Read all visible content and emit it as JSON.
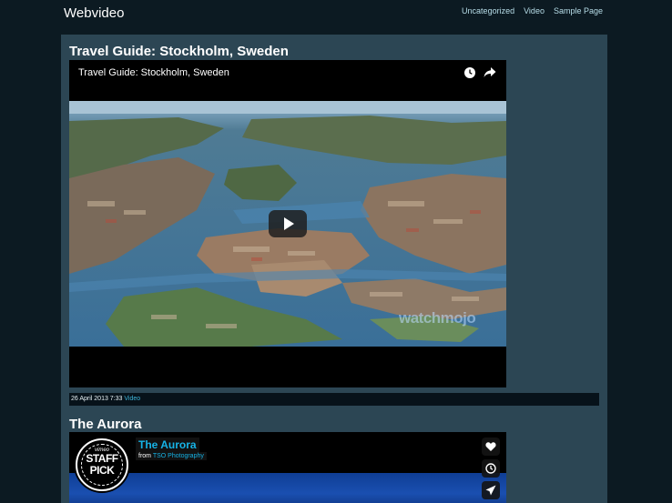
{
  "site": {
    "title": "Webvideo"
  },
  "nav": {
    "items": [
      "Uncategorized",
      "Video",
      "Sample Page"
    ]
  },
  "posts": [
    {
      "title": "Travel Guide: Stockholm, Sweden",
      "player": {
        "title": "Travel Guide: Stockholm, Sweden",
        "watermark": "watchmojo"
      },
      "meta": {
        "date": "26 April 2013 7:33",
        "category": "Video"
      }
    },
    {
      "title": "The Aurora",
      "player": {
        "badge_brand": "vimeo",
        "badge_line1": "STAFF",
        "badge_line2": "PICK",
        "title": "The Aurora",
        "from_label": "from",
        "author": "TSO Photography"
      }
    }
  ],
  "colors": {
    "background": "#0c1a22",
    "content": "#2c4654",
    "link": "#3eb4d8",
    "vimeo_accent": "#16b3e6"
  },
  "icons": {
    "youtube": [
      "clock-icon",
      "share-icon",
      "play-icon"
    ],
    "vimeo": [
      "heart-icon",
      "clock-icon",
      "send-icon"
    ]
  }
}
